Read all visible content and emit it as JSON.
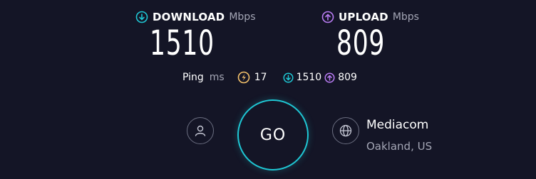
{
  "download": {
    "title": "DOWNLOAD",
    "unit": "Mbps",
    "value": "1510",
    "icon": "arrow-down-circle-icon",
    "color": "#1fc7d4"
  },
  "upload": {
    "title": "UPLOAD",
    "unit": "Mbps",
    "value": "809",
    "icon": "arrow-up-circle-icon",
    "color": "#b97cf3"
  },
  "ping": {
    "label": "Ping",
    "unit": "ms",
    "idle_icon": "lightning-circle-icon",
    "idle_value": "17",
    "download_value": "1510",
    "upload_value": "809",
    "idle_color": "#f5c26b"
  },
  "go_button": {
    "label": "GO",
    "color": "#1fc7d4"
  },
  "user": {
    "icon": "user-icon"
  },
  "server": {
    "icon": "globe-icon",
    "name": "Mediacom",
    "location": "Oakland, US"
  }
}
